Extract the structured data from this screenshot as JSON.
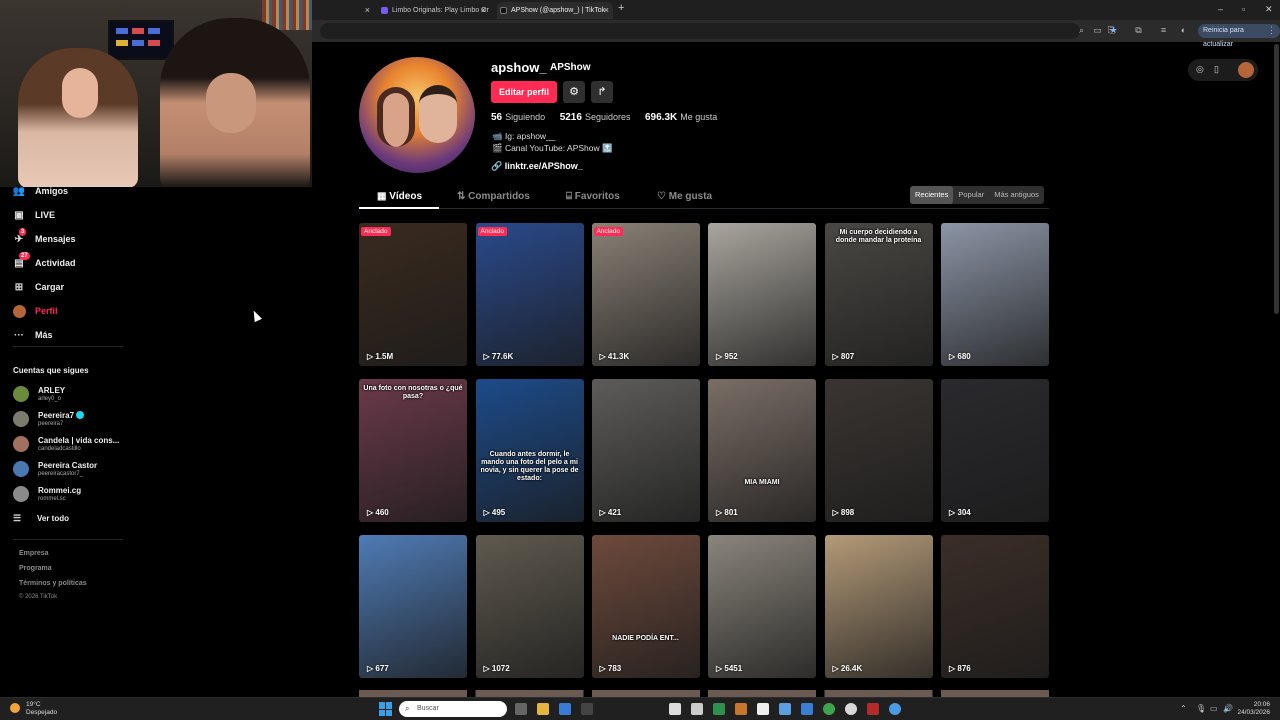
{
  "browser": {
    "tabs": [
      {
        "label": "Limbo Originals: Play Limbo Or"
      },
      {
        "label": "APShow (@apshow_) | TikTok"
      }
    ],
    "update_button": "Reinicia para actualizar"
  },
  "sidebar": {
    "nav": [
      {
        "label": "Amigos",
        "icon": "friends-icon"
      },
      {
        "label": "LIVE",
        "icon": "live-icon"
      },
      {
        "label": "Mensajes",
        "icon": "messages-icon",
        "badge": "3"
      },
      {
        "label": "Actividad",
        "icon": "activity-icon",
        "badge": "27"
      },
      {
        "label": "Cargar",
        "icon": "upload-icon"
      },
      {
        "label": "Perfil",
        "icon": "profile-avatar-icon"
      },
      {
        "label": "Más",
        "icon": "more-icon"
      }
    ],
    "following_title": "Cuentas que sigues",
    "following": [
      {
        "name": "ARLEY",
        "handle": "arley0_o",
        "verified": false
      },
      {
        "name": "Peereira7",
        "handle": "peereira7",
        "verified": true
      },
      {
        "name": "Candela | vida cons...",
        "handle": "candeladcastillo",
        "verified": false
      },
      {
        "name": "Peereira Castor",
        "handle": "peereiracastor7_",
        "verified": false
      },
      {
        "name": "Rommei.cg",
        "handle": "rommel.sc",
        "verified": false
      }
    ],
    "see_all": "Ver todo",
    "footer": [
      "Empresa",
      "Programa",
      "Términos y políticas"
    ],
    "copyright": "© 2026 TikTok"
  },
  "profile": {
    "username": "apshow_",
    "nickname": "APShow",
    "edit_button": "Editar perfil",
    "stats": [
      {
        "value": "56",
        "label": "Siguiendo"
      },
      {
        "value": "5216",
        "label": "Seguidores"
      },
      {
        "value": "696.3K",
        "label": "Me gusta"
      }
    ],
    "bio": [
      "📹 Ig: apshow__",
      "🎬 Canal YouTube: APShow 🔝"
    ],
    "link": "linktr.ee/APShow_"
  },
  "profile_tabs": [
    {
      "label": "Vídeos",
      "icon": "grid-icon"
    },
    {
      "label": "Compartidos",
      "icon": "repost-icon"
    },
    {
      "label": "Favoritos",
      "icon": "bookmark-icon"
    },
    {
      "label": "Me gusta",
      "icon": "heart-icon"
    }
  ],
  "sort_options": [
    "Recientes",
    "Popular",
    "Más antiguos"
  ],
  "sort_selected": "Recientes",
  "pinned_label": "Anclado",
  "videos": [
    {
      "views": "1.5M",
      "pinned": true,
      "caption": "",
      "color": "#3a2a1e"
    },
    {
      "views": "77.6K",
      "pinned": true,
      "caption": "",
      "color": "#2a4a8c"
    },
    {
      "views": "41.3K",
      "pinned": true,
      "caption": "",
      "color": "#8a8176"
    },
    {
      "views": "952",
      "pinned": false,
      "caption": "",
      "color": "#a9a59e"
    },
    {
      "views": "807",
      "pinned": false,
      "caption": "Mi cuerpo decidiendo a donde mandar la proteína",
      "color": "#4a4844"
    },
    {
      "views": "680",
      "pinned": false,
      "caption": "",
      "color": "#8c95a6"
    },
    {
      "views": "460",
      "pinned": false,
      "caption": "Una foto con nosotras o ¿qué pasa?",
      "color": "#6b3a4a"
    },
    {
      "views": "495",
      "pinned": false,
      "caption": "Cuando antes dormir, le mando una foto del pelo a mi novia, y sin querer la pose de estado:",
      "color": "#1c4b8a"
    },
    {
      "views": "421",
      "pinned": false,
      "caption": "",
      "color": "#5d5c5a"
    },
    {
      "views": "801",
      "pinned": false,
      "caption": "MIA MIAMI",
      "color": "#7a6e66"
    },
    {
      "views": "898",
      "pinned": false,
      "caption": "",
      "color": "#3a3532"
    },
    {
      "views": "304",
      "pinned": false,
      "caption": "",
      "color": "#2a2a2e"
    },
    {
      "views": "677",
      "pinned": false,
      "caption": "",
      "color": "#4f7bb5"
    },
    {
      "views": "1072",
      "pinned": false,
      "caption": "",
      "color": "#5f5a4f"
    },
    {
      "views": "783",
      "pinned": false,
      "caption": "NADIE PODÍA ENT...",
      "color": "#6e4a3c"
    },
    {
      "views": "5451",
      "pinned": false,
      "caption": "",
      "color": "#8a857c"
    },
    {
      "views": "26.4K",
      "pinned": false,
      "caption": "",
      "color": "#b39a78"
    },
    {
      "views": "876",
      "pinned": false,
      "caption": "",
      "color": "#3b2e28"
    }
  ],
  "taskbar": {
    "temperature": "19°C",
    "weather": "Despejado",
    "search_placeholder": "Buscar",
    "time": "20:06",
    "date": "24/03/2026"
  }
}
